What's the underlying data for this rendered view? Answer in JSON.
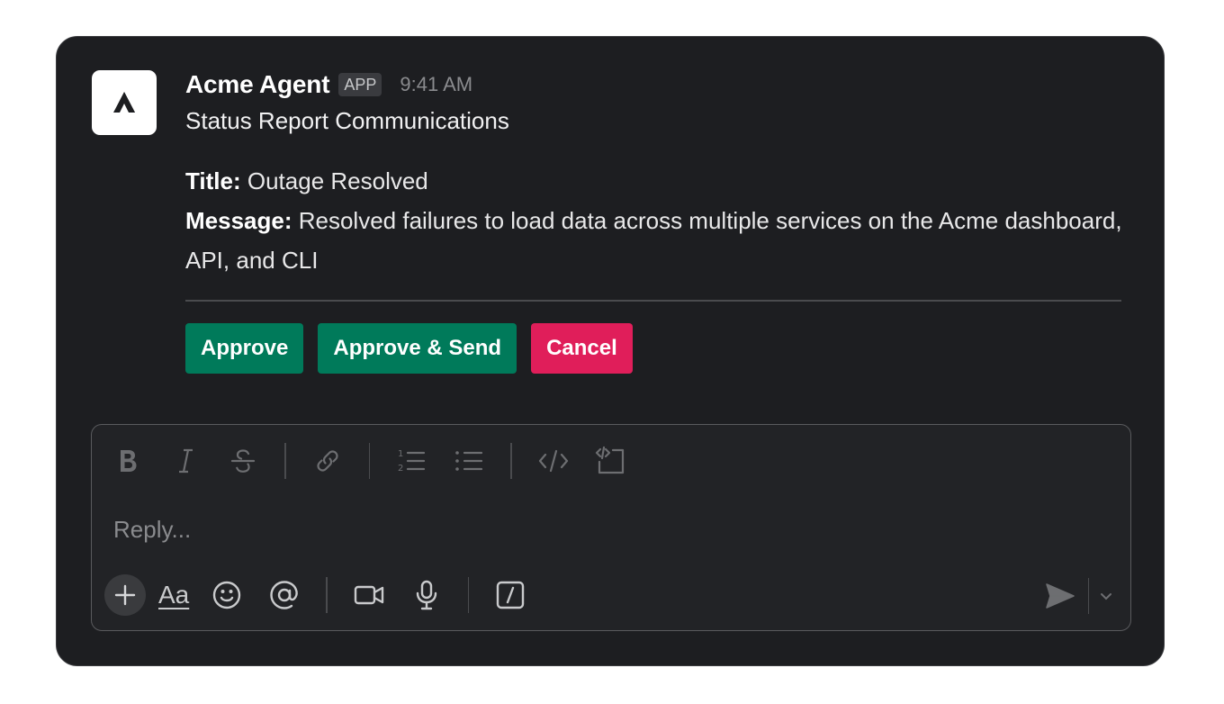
{
  "message": {
    "sender": "Acme Agent",
    "badge": "APP",
    "timestamp": "9:41 AM",
    "subtitle": "Status Report Communications",
    "title_label": "Title:",
    "title_value": " Outage Resolved",
    "message_label": "Message:",
    "message_value": " Resolved failures to load data across multiple services on the Acme dashboard, API, and CLI"
  },
  "actions": {
    "approve": "Approve",
    "approve_send": "Approve & Send",
    "cancel": "Cancel"
  },
  "composer": {
    "placeholder": "Reply...",
    "text_format_label": "Aa"
  },
  "colors": {
    "approve_green": "#007a5a",
    "cancel_red": "#e01e5a",
    "background": "#1d1e21"
  },
  "icons": {
    "formatting": [
      "bold-icon",
      "italic-icon",
      "strikethrough-icon",
      "link-icon",
      "ordered-list-icon",
      "bulleted-list-icon",
      "code-icon",
      "code-block-icon"
    ],
    "bottom": [
      "plus-icon",
      "text-format-icon",
      "emoji-icon",
      "mention-icon",
      "video-icon",
      "microphone-icon",
      "slash-command-icon",
      "send-icon",
      "chevron-down-icon"
    ]
  }
}
